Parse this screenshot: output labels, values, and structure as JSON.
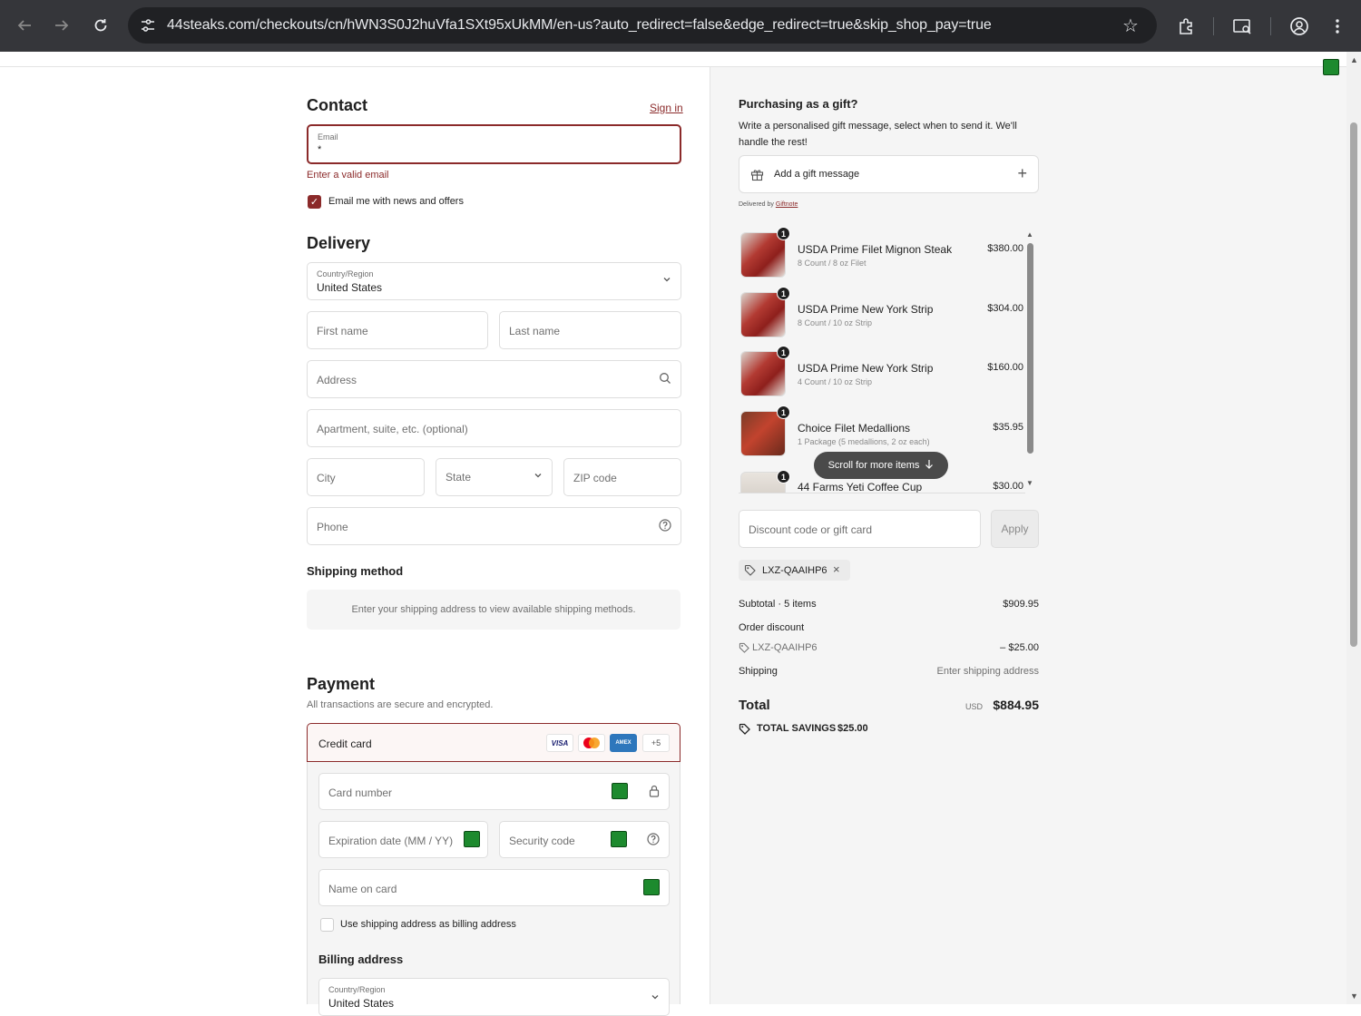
{
  "browser": {
    "url": "44steaks.com/checkouts/cn/hWN3S0J2huVfa1SXt95xUkMM/en-us?auto_redirect=false&edge_redirect=true&skip_shop_pay=true"
  },
  "contact": {
    "title": "Contact",
    "sign_in": "Sign in",
    "email_label": "Email",
    "email_value": "*",
    "email_error": "Enter a valid email",
    "newsletter_label": "Email me with news and offers",
    "newsletter_checked": true
  },
  "delivery": {
    "title": "Delivery",
    "country_label": "Country/Region",
    "country_value": "United States",
    "first_name": "First name",
    "last_name": "Last name",
    "address": "Address",
    "apartment": "Apartment, suite, etc. (optional)",
    "city": "City",
    "state": "State",
    "zip": "ZIP code",
    "phone": "Phone"
  },
  "shipping_method": {
    "title": "Shipping method",
    "note": "Enter your shipping address to view available shipping methods."
  },
  "payment": {
    "title": "Payment",
    "subtitle": "All transactions are secure and encrypted.",
    "credit_card": "Credit card",
    "card_logos": [
      "VISA",
      "MC",
      "AMEX",
      "+5"
    ],
    "card_number": "Card number",
    "expiration": "Expiration date (MM / YY)",
    "security_code": "Security code",
    "name_on_card": "Name on card",
    "use_shipping": "Use shipping address as billing address",
    "billing_title": "Billing address",
    "billing_country_label": "Country/Region",
    "billing_country_value": "United States"
  },
  "gift": {
    "title": "Purchasing as a gift?",
    "description": "Write a personalised gift message, select when to send it. We'll handle the rest!",
    "button": "Add a gift message",
    "delivered_by": "Delivered by",
    "delivered_by_link": "Giftnote"
  },
  "items": [
    {
      "qty": "1",
      "name": "USDA Prime Filet Mignon Steak",
      "sub": "8 Count / 8 oz Filet",
      "price": "$380.00"
    },
    {
      "qty": "1",
      "name": "USDA Prime New York Strip",
      "sub": "8 Count / 10 oz Strip",
      "price": "$304.00"
    },
    {
      "qty": "1",
      "name": "USDA Prime New York Strip",
      "sub": "4 Count / 10 oz Strip",
      "price": "$160.00"
    },
    {
      "qty": "1",
      "name": "Choice Filet Medallions",
      "sub": "1 Package (5 medallions, 2 oz each)",
      "price": "$35.95"
    },
    {
      "qty": "1",
      "name": "44 Farms Yeti Coffee Cup",
      "sub": "",
      "price": "$30.00"
    }
  ],
  "scroll_more": "Scroll for more items",
  "discount": {
    "placeholder": "Discount code or gift card",
    "apply": "Apply",
    "applied_code": "LXZ-QAAIHP6"
  },
  "summary": {
    "subtotal_label": "Subtotal · 5 items",
    "subtotal_value": "$909.95",
    "order_discount_label": "Order discount",
    "discount_code": "LXZ-QAAIHP6",
    "discount_value": "– $25.00",
    "shipping_label": "Shipping",
    "shipping_value": "Enter shipping address",
    "total_label": "Total",
    "currency": "USD",
    "total_value": "$884.95",
    "savings_label": "TOTAL SAVINGS",
    "savings_value": "$25.00"
  },
  "colors": {
    "accent": "#8b2a2a",
    "chrome_bg": "#35363a",
    "summary_bg": "#f5f5f5"
  }
}
